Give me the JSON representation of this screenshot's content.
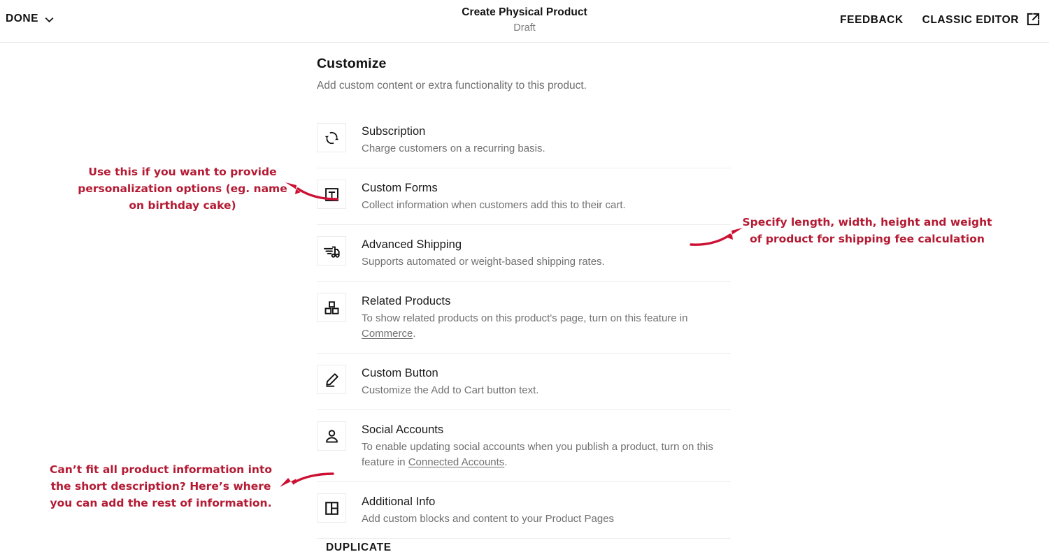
{
  "topbar": {
    "done_label": "DONE",
    "done_icon": "chevron-down-icon",
    "title": "Create Physical Product",
    "status": "Draft",
    "feedback_label": "FEEDBACK",
    "classic_editor_label": "CLASSIC EDITOR",
    "classic_editor_icon": "external-link-icon"
  },
  "panel": {
    "heading": "Customize",
    "subheading": "Add custom content or extra functionality to this product.",
    "rows": [
      {
        "icon": "subscription-sync-icon",
        "title": "Subscription",
        "desc": "Charge customers on a recurring basis."
      },
      {
        "icon": "custom-forms-text-box-icon",
        "title": "Custom Forms",
        "desc": "Collect information when customers add this to their cart."
      },
      {
        "icon": "advanced-shipping-truck-icon",
        "title": "Advanced Shipping",
        "desc": "Supports automated or weight-based shipping rates."
      },
      {
        "icon": "related-products-blocks-icon",
        "title": "Related Products",
        "desc_prefix": "To show related products on this product's page, turn on this feature in ",
        "desc_link": "Commerce",
        "desc_suffix": "."
      },
      {
        "icon": "custom-button-pencil-icon",
        "title": "Custom Button",
        "desc": "Customize the Add to Cart button text."
      },
      {
        "icon": "social-accounts-person-icon",
        "title": "Social Accounts",
        "desc_prefix": "To enable updating social accounts when you publish a product, turn on this feature in ",
        "desc_link": "Connected Accounts",
        "desc_suffix": "."
      },
      {
        "icon": "additional-info-layout-icon",
        "title": "Additional Info",
        "desc": "Add custom blocks and content to your Product Pages"
      }
    ],
    "duplicate_label": "DUPLICATE"
  },
  "annotations": {
    "color": "#b41a33",
    "custom_forms_note": "Use this if you want to provide personalization options (eg. name on birthday cake)",
    "advanced_shipping_note": "Specify length, width, height and weight of product for shipping fee calculation",
    "additional_info_note": "Can’t fit all product information into the short description? Here’s where you can add the rest of information."
  }
}
